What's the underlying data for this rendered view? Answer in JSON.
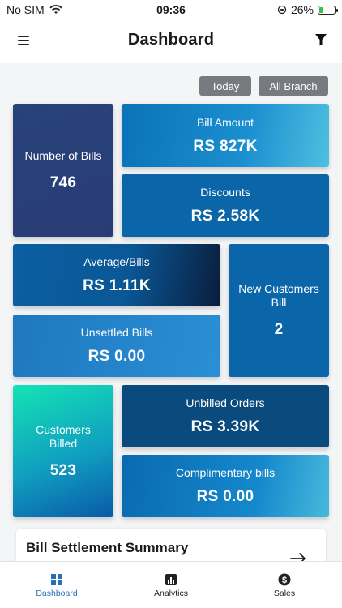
{
  "status_bar": {
    "carrier": "No SIM",
    "time": "09:36",
    "battery": "26%",
    "battery_level": 0.26
  },
  "header": {
    "title": "Dashboard"
  },
  "filters": {
    "date": "Today",
    "branch": "All Branch"
  },
  "tiles": {
    "number_of_bills": {
      "label": "Number of Bills",
      "value": "746"
    },
    "bill_amount": {
      "label": "Bill Amount",
      "value": "RS 827K"
    },
    "discounts": {
      "label": "Discounts",
      "value": "RS 2.58K"
    },
    "average_bills": {
      "label": "Average/Bills",
      "value": "RS 1.11K"
    },
    "new_customers_bill": {
      "label": "New Customers Bill",
      "value": "2"
    },
    "unsettled_bills": {
      "label": "Unsettled Bills",
      "value": "RS 0.00"
    },
    "customers_billed": {
      "label": "Customers Billed",
      "value": "523"
    },
    "unbilled_orders": {
      "label": "Unbilled Orders",
      "value": "RS 3.39K"
    },
    "complimentary_bills": {
      "label": "Complimentary bills",
      "value": "RS 0.00"
    }
  },
  "summary": {
    "title": "Bill Settlement Summary"
  },
  "bottom_nav": {
    "items": [
      {
        "label": "Dashboard",
        "icon": "grid-icon"
      },
      {
        "label": "Analytics",
        "icon": "chart-icon"
      },
      {
        "label": "Sales",
        "icon": "dollar-icon"
      }
    ]
  },
  "colors": {
    "accent": "#2a6fb6",
    "chip": "#777b80",
    "tile_dark": "#0a66a8"
  }
}
